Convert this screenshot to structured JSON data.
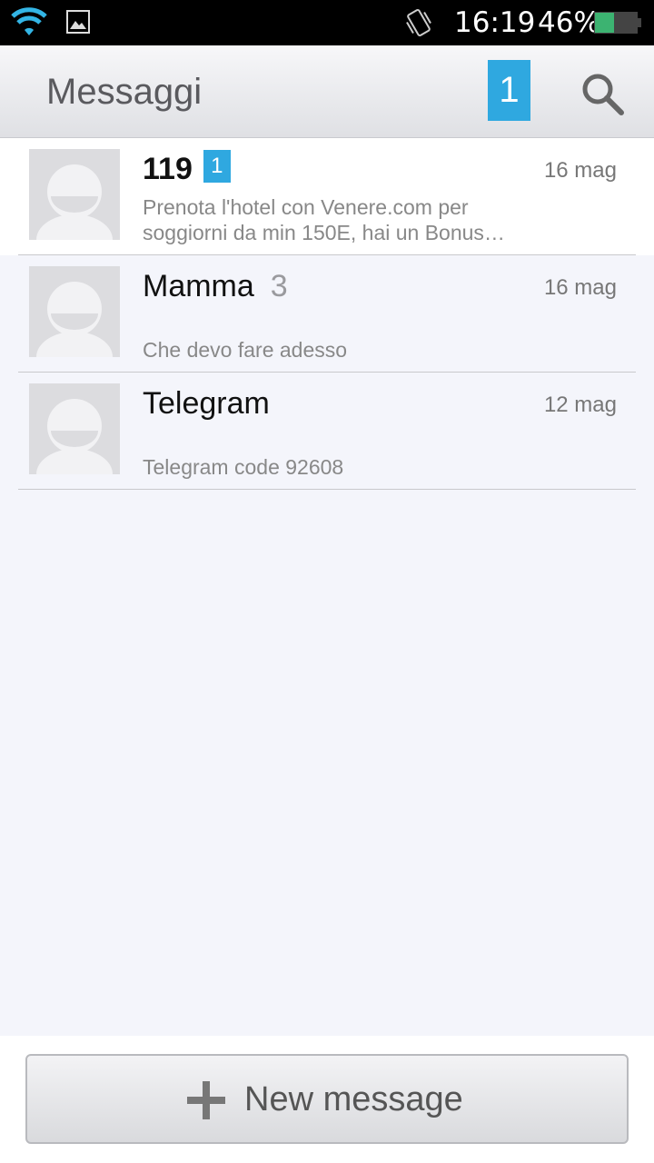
{
  "status_bar": {
    "time": "16:19",
    "battery_percent": "46%",
    "battery_level": 0.46,
    "icons": [
      "wifi-icon",
      "gallery-icon",
      "vibrate-icon",
      "battery-icon"
    ]
  },
  "action_bar": {
    "title": "Messaggi",
    "unread_count": "1",
    "search_icon": "search-icon"
  },
  "conversations": [
    {
      "name": "119",
      "badge": "1",
      "count": "",
      "date": "16 mag",
      "snippet": "Prenota l'hotel con Venere.com per soggiorni da min 150E, hai un Bonus…",
      "unread": true
    },
    {
      "name": "Mamma",
      "badge": "",
      "count": "3",
      "date": "16 mag",
      "snippet": "Che devo fare adesso",
      "unread": false
    },
    {
      "name": "Telegram",
      "badge": "",
      "count": "",
      "date": "12 mag",
      "snippet": "Telegram code 92608",
      "unread": false
    }
  ],
  "bottom": {
    "new_message_label": "New message",
    "icon": "plus-icon"
  },
  "colors": {
    "accent": "#2fa8e0",
    "list_background": "#f4f5fb",
    "battery_green": "#3cb371"
  }
}
